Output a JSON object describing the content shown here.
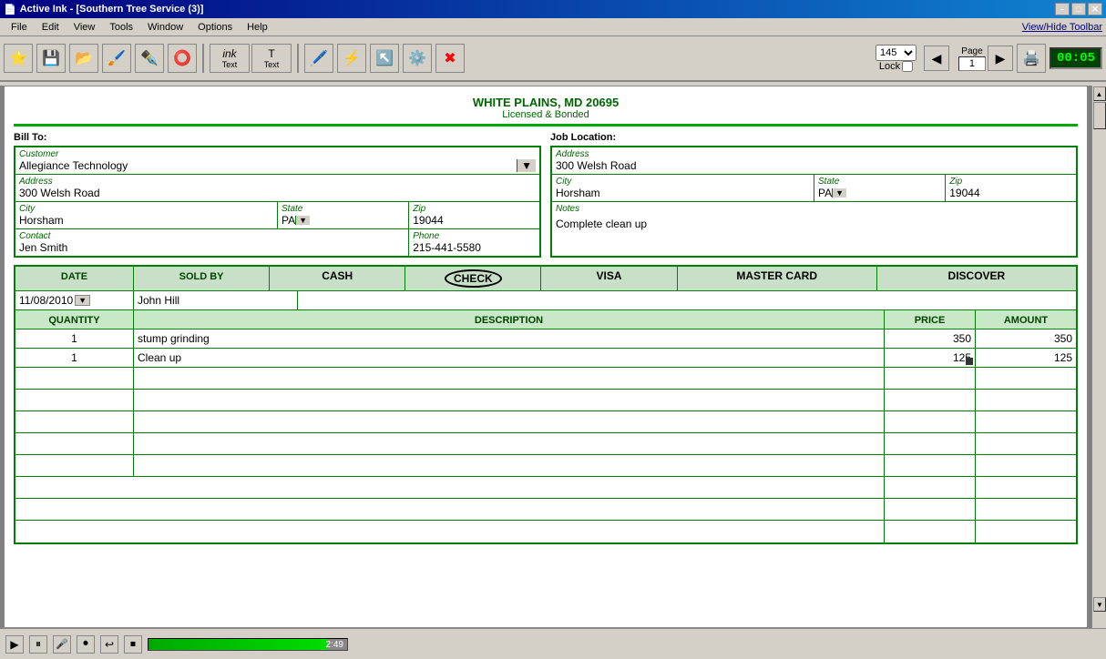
{
  "window": {
    "title": "Active Ink - [Southern Tree Service (3)]"
  },
  "titlebar": {
    "minimize": "–",
    "maximize": "□",
    "close": "✕",
    "app_minimize": "–",
    "app_maximize": "□",
    "app_close": "✕"
  },
  "menubar": {
    "items": [
      "File",
      "Edit",
      "View",
      "Tools",
      "Window",
      "Options",
      "Help"
    ],
    "view_hide": "View/Hide Toolbar"
  },
  "toolbar": {
    "zoom_value": "145",
    "lock_label": "Lock",
    "page_label": "Page",
    "page_value": "1",
    "timer": "00:05"
  },
  "header": {
    "company_name": "WHITE PLAINS, MD 20695",
    "licensed": "Licensed & Bonded"
  },
  "bill_to": {
    "label": "Bill To:",
    "customer_label": "Customer",
    "customer_value": "Allegiance Technology",
    "address_label": "Address",
    "address_value": "300 Welsh Road",
    "city_label": "City",
    "city_value": "Horsham",
    "state_label": "State",
    "state_value": "PA",
    "zip_label": "Zip",
    "zip_value": "19044",
    "contact_label": "Contact",
    "contact_value": "Jen Smith",
    "phone_label": "Phone",
    "phone_value": "215-441-5580"
  },
  "job_location": {
    "label": "Job Location:",
    "address_label": "Address",
    "address_value": "300 Welsh Road",
    "city_label": "City",
    "city_value": "Horsham",
    "state_label": "State",
    "state_value": "PA",
    "zip_label": "Zip",
    "zip_value": "19044",
    "notes_label": "Notes",
    "notes_value": "Complete clean up"
  },
  "payment": {
    "date_label": "DATE",
    "date_value": "11/08/2010",
    "sold_by_label": "SOLD BY",
    "sold_by_value": "John Hill",
    "options": [
      "CASH",
      "CHECK",
      "VISA",
      "MASTER CARD",
      "DISCOVER"
    ],
    "selected": "CHECK"
  },
  "table": {
    "headers": [
      "QUANTITY",
      "DESCRIPTION",
      "PRICE",
      "AMOUNT"
    ],
    "rows": [
      {
        "qty": "1",
        "desc": "stump grinding",
        "price": "350",
        "amount": "350"
      },
      {
        "qty": "1",
        "desc": "Clean up",
        "price": "125",
        "amount": "125"
      },
      {
        "qty": "",
        "desc": "",
        "price": "",
        "amount": ""
      },
      {
        "qty": "",
        "desc": "",
        "price": "",
        "amount": ""
      },
      {
        "qty": "",
        "desc": "",
        "price": "",
        "amount": ""
      },
      {
        "qty": "",
        "desc": "",
        "price": "",
        "amount": ""
      },
      {
        "qty": "",
        "desc": "",
        "price": "",
        "amount": ""
      }
    ],
    "summary_rows": [
      {
        "label": "",
        "value": ""
      },
      {
        "label": "",
        "value": ""
      },
      {
        "label": "",
        "value": ""
      }
    ]
  },
  "bottom_bar": {
    "progress_value": 90,
    "progress_label": "2:49",
    "play_icon": "▶",
    "pause_icon": "⏸",
    "mic_icon": "🎤",
    "record_icon": "⏺",
    "back_icon": "↩",
    "stop_icon": "⏹"
  }
}
